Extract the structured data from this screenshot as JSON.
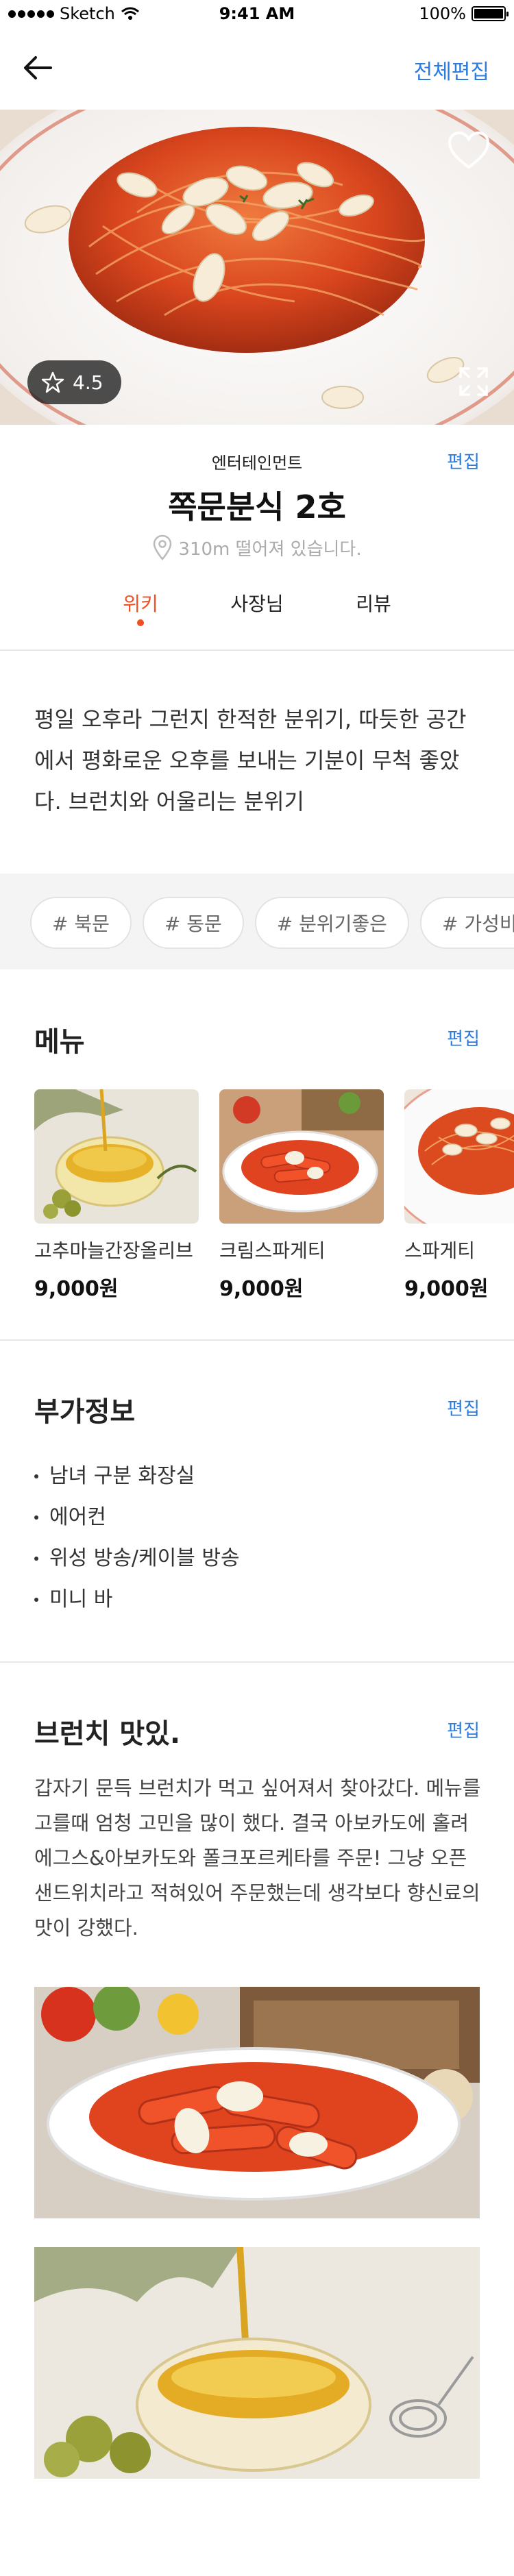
{
  "status_bar": {
    "carrier": "Sketch",
    "time": "9:41 AM",
    "battery": "100%"
  },
  "nav": {
    "edit_all": "전체편집"
  },
  "hero": {
    "rating": "4.5"
  },
  "place": {
    "category": "엔터테인먼트",
    "edit": "편집",
    "name": "쪽문분식 2호",
    "distance": "310m 떨어져 있습니다."
  },
  "tabs": [
    {
      "label": "위키",
      "active": true
    },
    {
      "label": "사장님",
      "active": false
    },
    {
      "label": "리뷰",
      "active": false
    }
  ],
  "description": "평일 오후라 그런지 한적한 분위기, 따듯한 공간에서 평화로운 오후를 보내는 기분이 무척 좋았다. 브런치와 어울리는 분위기",
  "tags": [
    "# 북문",
    "# 동문",
    "# 분위기좋은",
    "# 가성비"
  ],
  "menu": {
    "title": "메뉴",
    "edit": "편집",
    "items": [
      {
        "name": "고추마늘간장올리브",
        "price": "9,000원"
      },
      {
        "name": "크림스파게티",
        "price": "9,000원"
      },
      {
        "name": "스파게티",
        "price": "9,000원"
      }
    ]
  },
  "extra": {
    "title": "부가정보",
    "edit": "편집",
    "items": [
      "남녀 구분 화장실",
      "에어컨",
      "위성 방송/케이블 방송",
      "미니 바"
    ]
  },
  "review": {
    "title": "브런치 맛있.",
    "edit": "편집",
    "text": "갑자기 문득 브런치가 먹고 싶어져서 찾아갔다. 메뉴를 고를때 엄청 고민을 많이 했다. 결국 아보카도에 홀려 에그스&아보카도와 폴크포르케타를 주문! 그냥 오픈샌드위치라고 적혀있어 주문했는데 생각보다 향신료의 맛이 강했다."
  },
  "colors": {
    "accent_blue": "#2b7be0",
    "active_tab": "#f04e23",
    "tag_bg": "#f4f4f4"
  }
}
